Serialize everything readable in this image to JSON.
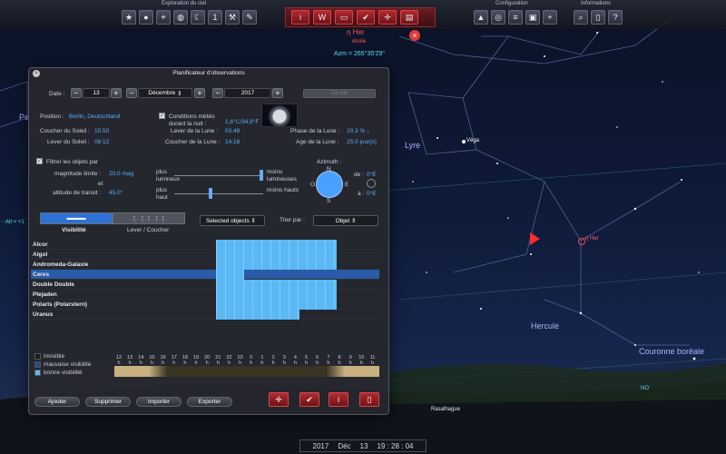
{
  "toolbar": {
    "sky_exploration_title": "Exploration du ciel",
    "configuration_title": "Configuration",
    "information_title": "Informations",
    "sky_buttons": [
      "sky-view-icon",
      "planet-icon",
      "telescope-icon",
      "globe-icon",
      "moon-icon",
      "number-icon",
      "tool-icon",
      "pen-icon"
    ],
    "red_buttons": [
      "i",
      "W",
      "▭",
      "✔",
      "✛",
      "▤"
    ],
    "config_buttons": [
      "landscape-icon",
      "grid-globe-icon",
      "sliders-icon",
      "display-icon",
      "add-icon"
    ],
    "info_buttons": [
      "🔍",
      "📖",
      "?"
    ]
  },
  "sky": {
    "target_name": "η Her",
    "target_type": "étoile",
    "azimuth": "Azm = 265°35'29\"",
    "constellations": {
      "lyre": "Lyre",
      "hercule": "Hercule",
      "couronne": "Couronne boréale",
      "pe": "Pe"
    },
    "stars": {
      "vega": "Véga",
      "eta_her": "η Her"
    },
    "alt_label": "Alt = +1",
    "ne_label": "NO",
    "rasalhague": "Rasalhague"
  },
  "planner": {
    "title": "Planificateur d'observations",
    "date_label": "Date :",
    "day": "13",
    "month": "Décembre",
    "year": "2017",
    "today_button": "Ce soir",
    "position_label": "Position :",
    "position_value": "Berlin, Deutschland",
    "conditions_label": "Conditions météo durant la nuit :",
    "conditions_value": "1,6°C/34,9°F",
    "sunset_label": "Coucher du Soleil :",
    "sunset_value": "15:50",
    "sunrise_label": "Lever du Soleil :",
    "sunrise_value": "08:12",
    "moonrise_label": "Lever de la Lune :",
    "moonrise_value": "03:48",
    "moonset_label": "Coucher de la Lune :",
    "moonset_value": "14:18",
    "moon_phase_label": "Phase de la Lune :",
    "moon_phase_value": "20.3 % ↓",
    "moon_age_label": "Age de la Lune :",
    "moon_age_value": "25.0 jour(s)",
    "filter_label": "Filtrer les objets par",
    "mag_label": "magnitude limite :",
    "mag_value": "20.0 mag",
    "and_label": "et",
    "alt_label": "altitude de transit :",
    "alt_value": "45.0°",
    "slider1_left": "plus lumineux",
    "slider1_right": "moins lumineuses",
    "slider2_left": "plus haut",
    "slider2_right": "moins hauts",
    "slider1_level": 1.0,
    "slider2_level": 0.4,
    "azimuth_label": "Azimuth :",
    "az_from_label": "de :",
    "az_from_value": "0°E",
    "az_to_label": "à :",
    "az_to_value": "0°E",
    "compass_n": "N",
    "compass_e": "E",
    "compass_s": "S",
    "compass_o": "O",
    "tab_visibility": "Visibilité",
    "tab_rise_set": "Lever / Coucher",
    "selected_objects": "Selected objects",
    "sort_label": "Trier par :",
    "sort_value": "Objet",
    "objects": [
      "Alcor",
      "Algol",
      "Andromeda-Galaxie",
      "Ceres",
      "Double Double",
      "Plejaden",
      "Polaris (Polarstern)",
      "Uranus"
    ],
    "visibility_ranges": [
      [
        0.385,
        0.84
      ],
      [
        0.385,
        0.84
      ],
      [
        0.385,
        0.84
      ],
      [
        0.385,
        0.49
      ],
      [
        0.385,
        0.84
      ],
      [
        0.385,
        0.84
      ],
      [
        0.385,
        0.84
      ],
      [
        0.385,
        0.7
      ]
    ],
    "legend_invisible": "invisible",
    "legend_bad": "mauvaise visibilité",
    "legend_good": "bonne visibilité",
    "hours": [
      "12",
      "13",
      "14",
      "15",
      "16",
      "17",
      "18",
      "19",
      "20",
      "21",
      "22",
      "23",
      "0",
      "1",
      "2",
      "3",
      "4",
      "5",
      "6",
      "7",
      "8",
      "9",
      "10",
      "11"
    ],
    "hour_unit": "h",
    "add_button": "Ajouter",
    "remove_button": "Supprimer",
    "import_button": "Importer",
    "export_button": "Exporter",
    "action_buttons": [
      "✛",
      "✔",
      "i",
      "📖"
    ]
  },
  "time": {
    "year": "2017",
    "month": "Déc",
    "day": "13",
    "clock": "19 : 28 : 04"
  },
  "colors": {
    "good_visibility": "#5ab8f5",
    "bad_visibility": "#1e4f86",
    "invisible": "#1a1c22",
    "accent_red": "#b22a30"
  }
}
